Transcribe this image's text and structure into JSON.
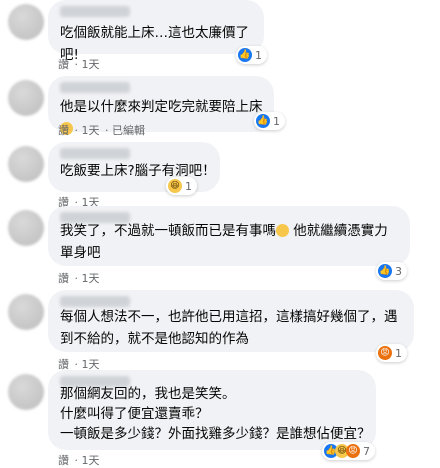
{
  "comments": [
    {
      "text": "吃個飯就能上床…這也太廉價了吧!",
      "reaction_count": "1",
      "actions": [
        "讚",
        "1天"
      ]
    },
    {
      "text": "他是以什麼來判定吃完就要陪上床",
      "reaction_count": "1",
      "actions": [
        "讚",
        "1天",
        "已編輯"
      ]
    },
    {
      "text": "吃飯要上床?腦子有洞吧！",
      "reaction_count": "1",
      "actions": [
        "讚",
        "1天"
      ]
    },
    {
      "text": "我笑了，不過就一頓飯而已是有事嗎",
      "text_cont": " 他就繼續憑實力\n單身吧",
      "reaction_count": "3",
      "actions": [
        "讚",
        "1天"
      ]
    },
    {
      "text": "每個人想法不一，也許他已用這招，這樣搞好幾個了，遇\n到不給的，就不是他認知的作為",
      "reaction_count": "1",
      "actions": [
        "讚",
        "1天"
      ]
    },
    {
      "text": "那個網友回的，我也是笑笑。\n什麼叫得了便宜還賣乖？\n一頓飯是多少錢？外面找雞多少錢？是誰想佔便宜？",
      "reaction_count": "7",
      "actions": [
        "讚",
        "1天"
      ]
    }
  ],
  "colors": {
    "bubble": "#f0f2f5",
    "meta": "#65676b",
    "like": "#1877f2",
    "haha": "#f7c74c",
    "angry": "#e9710f"
  },
  "icons": {
    "like": "thumbs-up-icon",
    "haha": "laughing-face-icon",
    "angry": "angry-face-icon",
    "sad": "sad-face-icon"
  }
}
